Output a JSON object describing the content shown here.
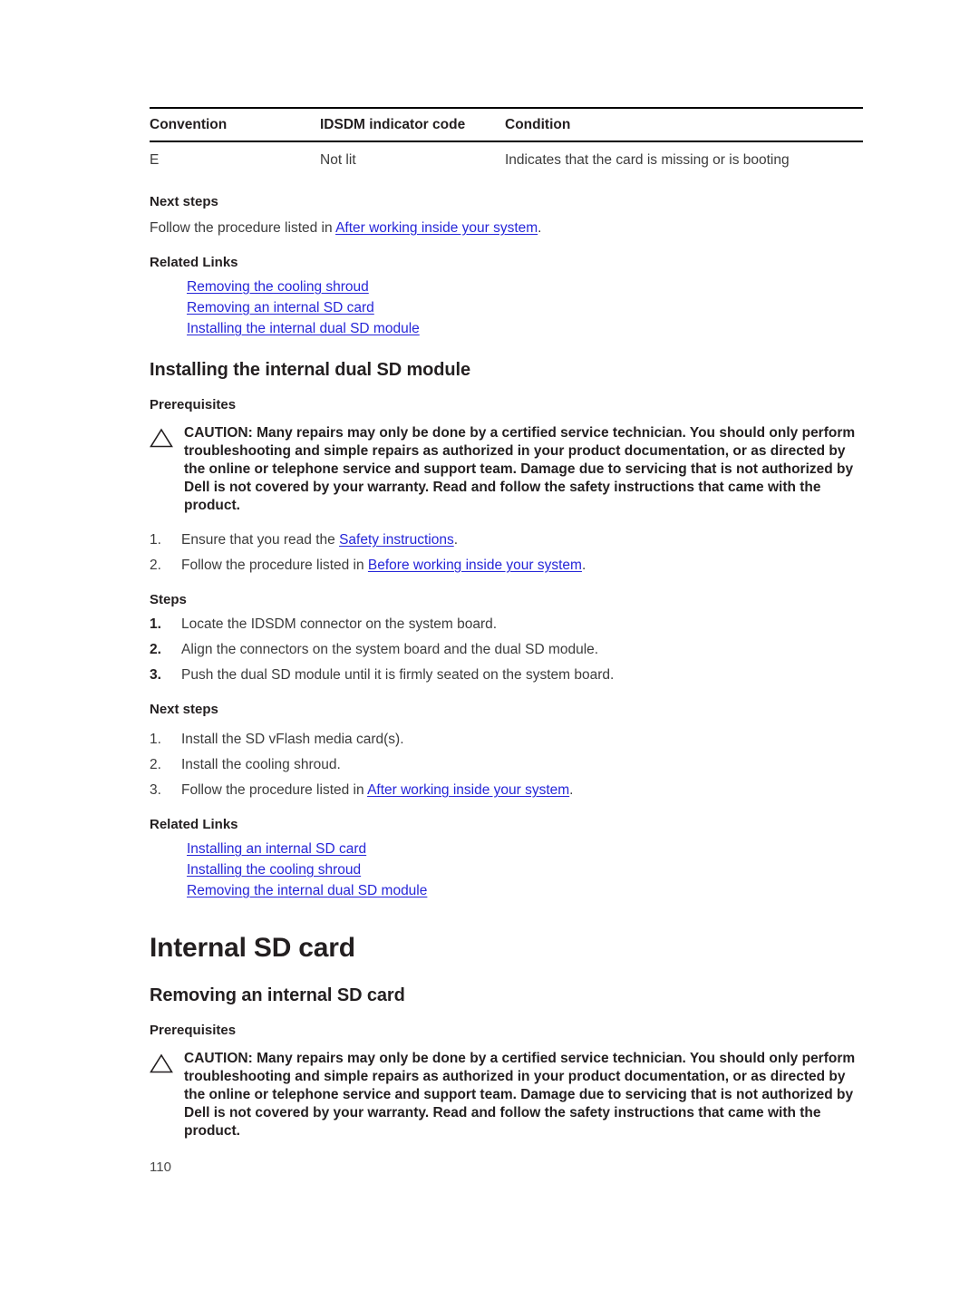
{
  "page": {
    "number": "110"
  },
  "table": {
    "headers": [
      "Convention",
      "IDSDM indicator code",
      "Condition"
    ],
    "rows": [
      [
        "E",
        "Not lit",
        "Indicates that the card is missing or is booting"
      ]
    ]
  },
  "section_next_steps_1": {
    "label": "Next steps",
    "text_before": "Follow the procedure listed in ",
    "link": "After working inside your system",
    "text_after": "."
  },
  "section_related_links_1": {
    "label": "Related Links",
    "links": [
      "Removing the cooling shroud",
      "Removing an internal SD card",
      "Installing the internal dual SD module"
    ]
  },
  "section_installing_dual_sd": {
    "heading": "Installing the internal dual SD module",
    "prerequisites_label": "Prerequisites",
    "caution": "CAUTION: Many repairs may only be done by a certified service technician. You should only perform troubleshooting and simple repairs as authorized in your product documentation, or as directed by the online or telephone service and support team. Damage due to servicing that is not authorized by Dell is not covered by your warranty. Read and follow the safety instructions that came with the product.",
    "prereq_steps": [
      {
        "num": "1.",
        "text_before": "Ensure that you read the ",
        "link": "Safety instructions",
        "text_after": "."
      },
      {
        "num": "2.",
        "text_before": "Follow the procedure listed in ",
        "link": "Before working inside your system",
        "text_after": "."
      }
    ],
    "steps_label": "Steps",
    "steps": [
      {
        "num": "1.",
        "text_before": "Locate the IDSDM connector on the system board.",
        "link": "",
        "text_after": ""
      },
      {
        "num": "2.",
        "text_before": "Align the connectors on the system board and the dual SD module.",
        "link": "",
        "text_after": ""
      },
      {
        "num": "3.",
        "text_before": "Push the dual SD module until it is firmly seated on the system board.",
        "link": "",
        "text_after": ""
      }
    ],
    "next_steps_label": "Next steps",
    "next_steps": [
      {
        "num": "1.",
        "text_before": "Install the SD vFlash media card(s).",
        "link": "",
        "text_after": ""
      },
      {
        "num": "2.",
        "text_before": "Install the cooling shroud.",
        "link": "",
        "text_after": ""
      },
      {
        "num": "3.",
        "text_before": "Follow the procedure listed in ",
        "link": "After working inside your system",
        "text_after": "."
      }
    ],
    "related_links_label": "Related Links",
    "related_links": [
      "Installing an internal SD card",
      "Installing the cooling shroud",
      "Removing the internal dual SD module"
    ]
  },
  "section_internal_sd_card": {
    "heading": "Internal SD card",
    "subheading": "Removing an internal SD card",
    "prerequisites_label": "Prerequisites",
    "caution": "CAUTION: Many repairs may only be done by a certified service technician. You should only perform troubleshooting and simple repairs as authorized in your product documentation, or as directed by the online or telephone service and support team. Damage due to servicing that is not authorized by Dell is not covered by your warranty. Read and follow the safety instructions that came with the product."
  },
  "colors": {
    "link": "#2626d8",
    "text": "#3c3c3c",
    "heading": "#231f20",
    "rule": "#000000"
  },
  "icons": {
    "caution": "caution-triangle-icon"
  }
}
